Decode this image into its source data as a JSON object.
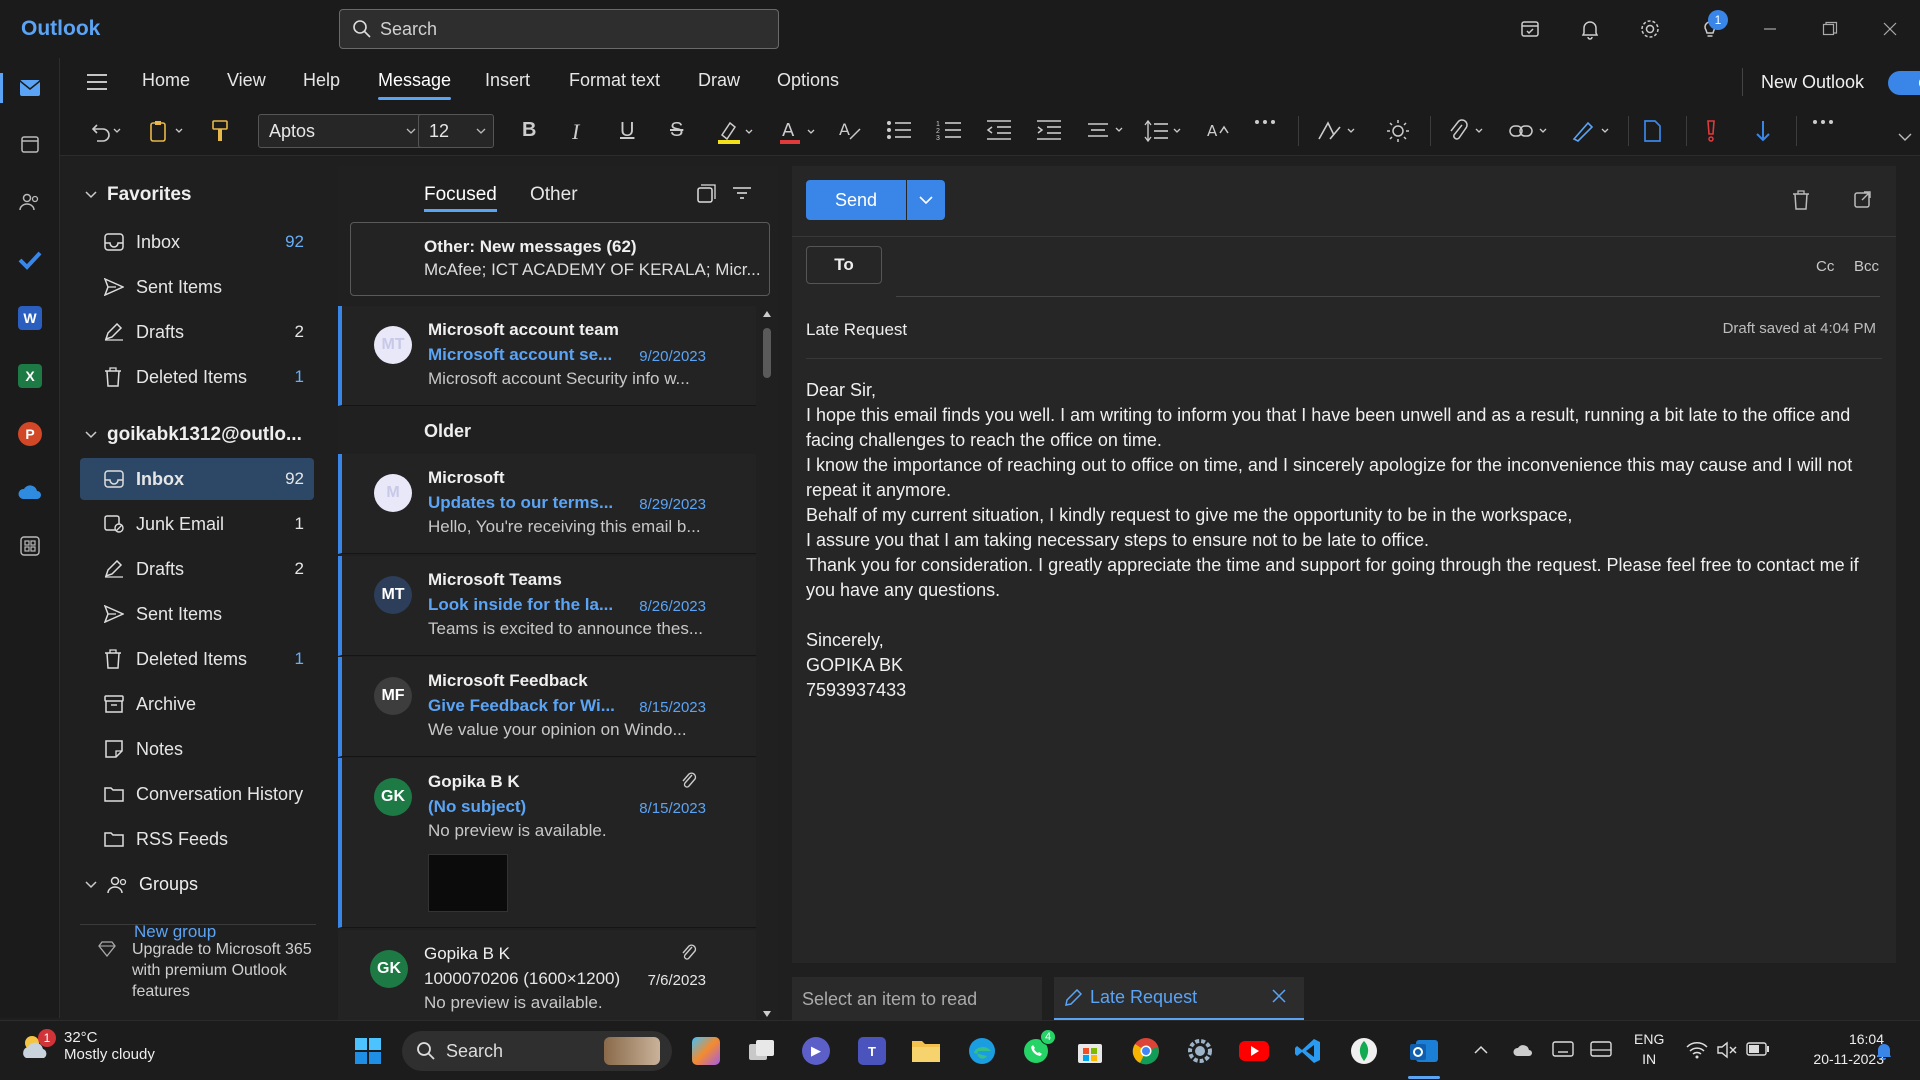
{
  "app": {
    "name": "Outlook"
  },
  "search": {
    "placeholder": "Search"
  },
  "titlebar": {
    "tips_badge": "1"
  },
  "ribbon": {
    "tabs": [
      "Home",
      "View",
      "Help",
      "Message",
      "Insert",
      "Format text",
      "Draw",
      "Options"
    ],
    "active_tab": "Message",
    "new_outlook_label": "New Outlook",
    "font_name": "Aptos",
    "font_size": "12"
  },
  "folders": {
    "favorites_label": "Favorites",
    "favorites": [
      {
        "label": "Inbox",
        "count": "92"
      },
      {
        "label": "Sent Items",
        "count": ""
      },
      {
        "label": "Drafts",
        "count": "2"
      },
      {
        "label": "Deleted Items",
        "count": "1"
      }
    ],
    "account_label": "goikabk1312@outlo...",
    "account_items": [
      {
        "label": "Inbox",
        "count": "92"
      },
      {
        "label": "Junk Email",
        "count": "1"
      },
      {
        "label": "Drafts",
        "count": "2"
      },
      {
        "label": "Sent Items",
        "count": ""
      },
      {
        "label": "Deleted Items",
        "count": "1"
      },
      {
        "label": "Archive",
        "count": ""
      },
      {
        "label": "Notes",
        "count": ""
      },
      {
        "label": "Conversation History",
        "count": ""
      },
      {
        "label": "RSS Feeds",
        "count": ""
      }
    ],
    "groups_label": "Groups",
    "new_group_label": "New group",
    "upgrade_text": "Upgrade to Microsoft 365 with premium Outlook features"
  },
  "message_list": {
    "tab_focused": "Focused",
    "tab_other": "Other",
    "other_title": "Other: New messages (62)",
    "other_senders": "McAfee; ICT ACADEMY OF KERALA; Micr...",
    "older_label": "Older",
    "messages": [
      {
        "initials": "MT",
        "from": "Microsoft account team",
        "subject": "Microsoft account se...",
        "date": "9/20/2023",
        "preview": "Microsoft account Security info w...",
        "avatar_color": "#e8e8f8",
        "avatar_text": "#c8c8e8"
      },
      {
        "initials": "M",
        "from": "Microsoft",
        "subject": "Updates to our terms...",
        "date": "8/29/2023",
        "preview": "Hello, You're receiving this email b...",
        "avatar_color": "#e8e8f8",
        "avatar_text": "#c8c8e8"
      },
      {
        "initials": "MT",
        "from": "Microsoft Teams",
        "subject": "Look inside for the la...",
        "date": "8/26/2023",
        "preview": "Teams is excited to announce thes...",
        "avatar_color": "#2c3e5a",
        "avatar_text": "#ffffff"
      },
      {
        "initials": "MF",
        "from": "Microsoft Feedback",
        "subject": "Give Feedback for Wi...",
        "date": "8/15/2023",
        "preview": "We value your opinion on Windo...",
        "avatar_color": "#3d3d3d",
        "avatar_text": "#ffffff"
      },
      {
        "initials": "GK",
        "from": "Gopika B K",
        "subject": "(No subject)",
        "date": "8/15/2023",
        "preview": "No preview is available.",
        "avatar_color": "#1e7a45",
        "avatar_text": "#ffffff"
      },
      {
        "initials": "GK",
        "from": "Gopika B K",
        "subject": "1000070206 (1600×1200)",
        "date": "7/6/2023",
        "preview": "No preview is available.",
        "avatar_color": "#1e7a45",
        "avatar_text": "#ffffff"
      }
    ]
  },
  "compose": {
    "send_label": "Send",
    "to_label": "To",
    "cc_label": "Cc",
    "bcc_label": "Bcc",
    "subject": "Late Request",
    "draft_saved": "Draft saved at 4:04 PM",
    "body_lines": [
      "Dear Sir,",
      "I hope this email finds you well. I am writing to inform you that I have been unwell and as a result,  running a bit late to the office and facing challenges to reach the office on time.",
      "I know the importance of reaching out to office on time, and I sincerely apologize for the inconvenience this may cause and I will not repeat it anymore.",
      "Behalf of my current situation, I kindly request to give me the opportunity to be in the workspace,",
      "I assure you that I am taking  necessary steps to ensure not to be late to office.",
      "Thank you for consideration. I greatly appreciate the time and support for going through the request. Please feel free to contact me if you have any questions.",
      "",
      "Sincerely,",
      "GOPIKA BK",
      "7593937433"
    ]
  },
  "bottom_tabs": {
    "reading_placeholder": "Select an item to read",
    "draft_tab": "Late Request"
  },
  "taskbar": {
    "temperature": "32°C",
    "condition": "Mostly cloudy",
    "weather_badge": "1",
    "search_label": "Search",
    "whatsapp_badge": "4",
    "lang_top": "ENG",
    "lang_bottom": "IN",
    "time": "16:04",
    "date": "20-11-2023"
  },
  "colors": {
    "accent": "#3a86e8",
    "link": "#5ba4f5",
    "selected_folder": "#2d4866"
  }
}
